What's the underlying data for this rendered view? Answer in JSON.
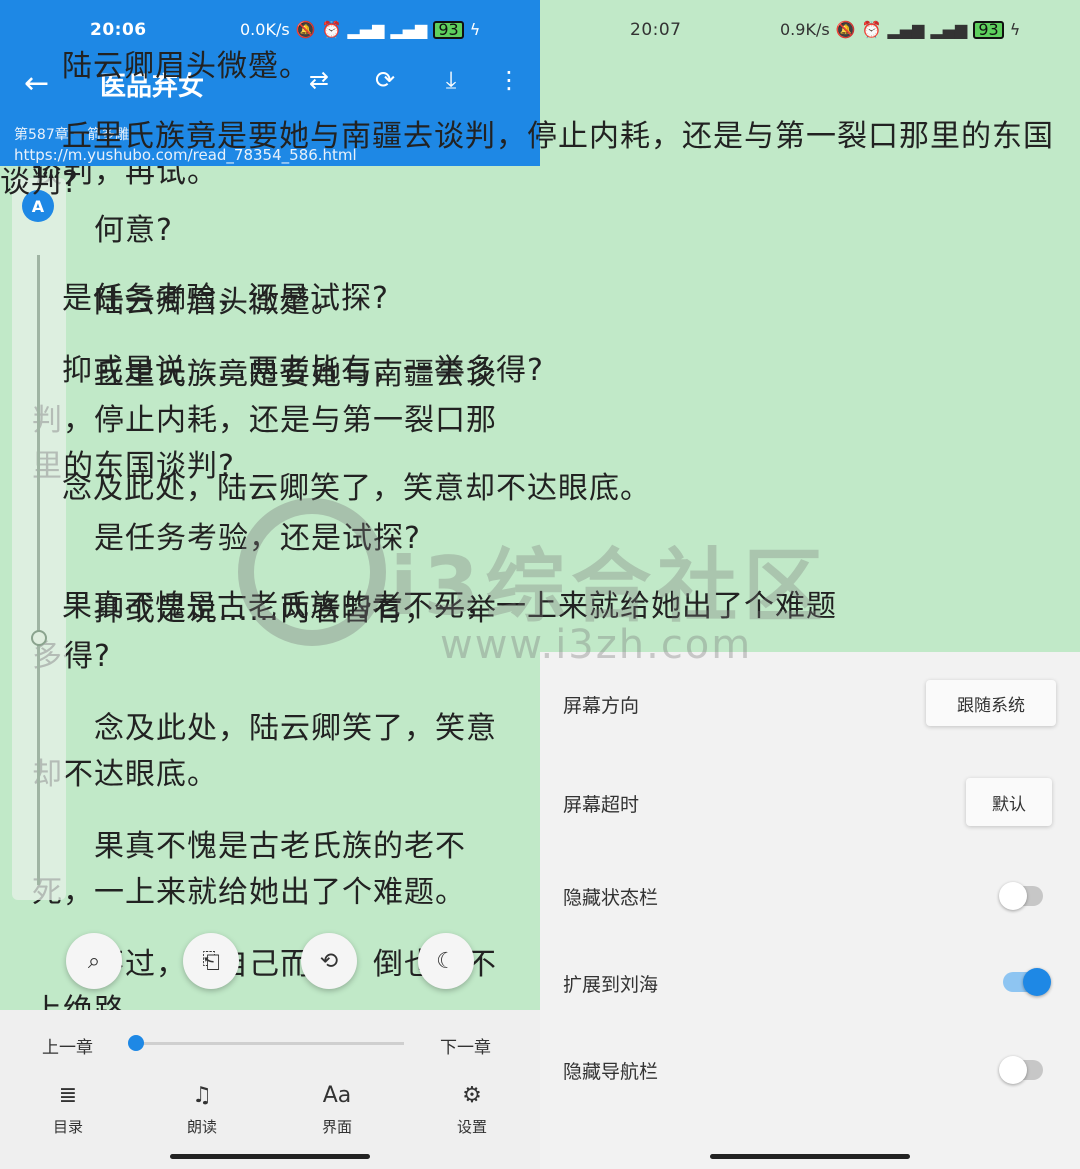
{
  "left": {
    "status": {
      "time": "20:06",
      "speed": "0.0K/s",
      "battery": "93"
    },
    "appbar": {
      "back_icon": "←",
      "title": "医品弃女",
      "icons": [
        "⇄",
        "⟳",
        "⤓",
        "⋮"
      ],
      "chapter_name": "第587章 一箭多雕",
      "chapter_url": "https://m.yushubo.com/read_78354_586.html"
    },
    "paragraphs": [
      "谈判，再试。",
      "　　何意?",
      "　　陆云卿眉头微蹙。",
      "　　丘里氏族竟是要她与南疆去谈判，停止内耗，还是与第一裂口那里的东国谈判?",
      "　　是任务考验，还是试探?",
      "　　抑或是说……两者皆有，一举多得?",
      "　　念及此处，陆云卿笑了，笑意却不达眼底。",
      "　　果真不愧是古老氏族的老不死，一上来就给她出了个难题。",
      "　　不过，对自己而言，倒也称不上绝路"
    ],
    "brightness_label": "A",
    "fabs": [
      "⌕",
      "⎗",
      "⟲",
      "☾"
    ],
    "bottom": {
      "prev": "上一章",
      "next": "下一章",
      "menu": [
        {
          "icon": "≣",
          "label": "目录"
        },
        {
          "icon": "♫",
          "label": "朗读"
        },
        {
          "icon": "Aa",
          "label": "界面"
        },
        {
          "icon": "⚙",
          "label": "设置"
        }
      ]
    }
  },
  "right": {
    "status": {
      "time": "20:07",
      "speed": "0.9K/s",
      "battery": "93"
    },
    "paragraphs": [
      "　　陆云卿眉头微蹙。",
      "　　丘里氏族竟是要她与南疆去谈判，停止内耗，还是与第一裂口那里的东国谈判?",
      "　　是任务考验，还是试探?",
      "　　抑或是说……两者皆有，一举多得?",
      "　　念及此处，陆云卿笑了，笑意却不达眼底。",
      "　　果真不愧是古老氏族的老不死，一上来就给她出了个难题"
    ],
    "settings": [
      {
        "label": "屏幕方向",
        "type": "button",
        "value": "跟随系统"
      },
      {
        "label": "屏幕超时",
        "type": "button",
        "value": "默认"
      },
      {
        "label": "隐藏状态栏",
        "type": "toggle",
        "on": false
      },
      {
        "label": "扩展到刘海",
        "type": "toggle",
        "on": true
      },
      {
        "label": "隐藏导航栏",
        "type": "toggle",
        "on": false
      }
    ]
  },
  "watermark": {
    "text": "i3综合社区",
    "url": "www.i3zh.com"
  }
}
